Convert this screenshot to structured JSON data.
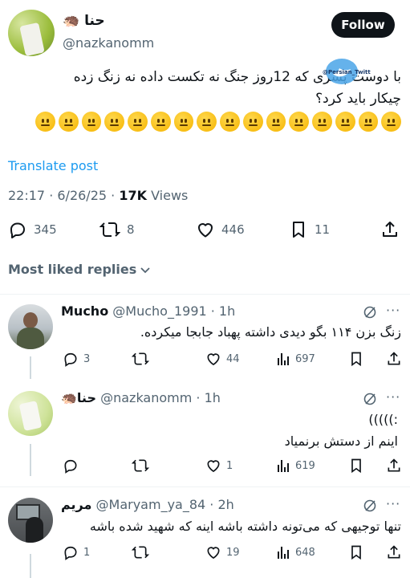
{
  "tweet": {
    "author_name": "حنا",
    "author_emoji": "🦔",
    "handle": "@nazkanomm",
    "follow_label": "Follow",
    "text_line1": "با دوست پسری که 12روز جنگ  نه تکست داده نه زنگ زده",
    "text_line2": "چیکار باید کرد؟",
    "emoji_count": 16,
    "watermark": "@Persian_Twitt",
    "translate_label": "Translate post",
    "timestamp": "22:17 · 6/26/25 · ",
    "views_count": "17K",
    "views_label": " Views",
    "replies": "345",
    "reposts": "8",
    "likes": "446",
    "bookmarks": "11"
  },
  "replies_header": "Most liked replies",
  "replies": [
    {
      "name": "Mucho",
      "handle": "@Mucho_1991 · 1h",
      "text": "زنگ بزن ۱۱۴ بگو دیدی داشته پهباد جابجا میکرده.",
      "replies": "3",
      "likes": "44",
      "views": "697"
    },
    {
      "name": "حنا",
      "emoji": "🦔",
      "handle": "@nazkanomm · 1h",
      "text_line1": "(((((:",
      "text_line2": "اینم از دستش برنمیاد",
      "replies": "",
      "likes": "1",
      "views": "619"
    },
    {
      "name": "مریم",
      "handle": "@Maryam_ya_84 · 2h",
      "text": "تنها توجیهی که می‌تونه داشته باشه اینه که شهید شده باشه",
      "replies": "1",
      "likes": "19",
      "views": "648"
    }
  ],
  "colors": {
    "link": "#1d9bf0",
    "grey": "#536471",
    "text": "#0f1419"
  }
}
